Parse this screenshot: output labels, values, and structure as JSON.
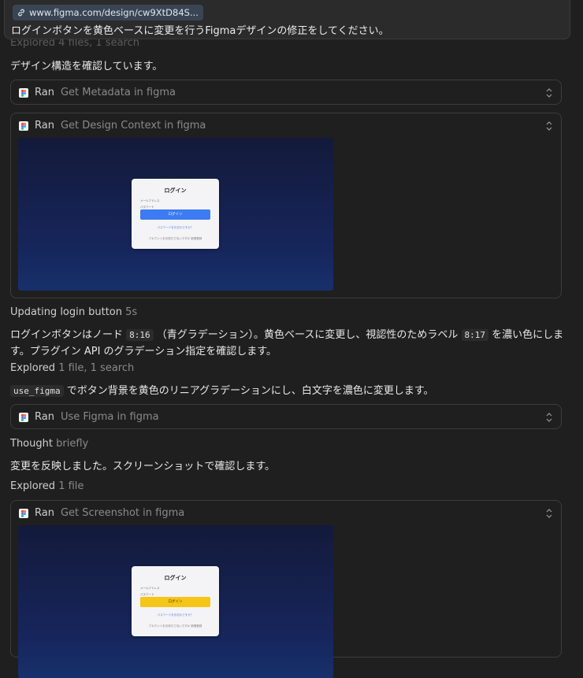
{
  "prompt": {
    "url": "www.figma.com/design/cw9XtD84S...",
    "text": "ログインボタンを黄色ベースに変更を行うFigmaデザインの修正をしてください。"
  },
  "explored_faded": "Explored 4 files, 1 search",
  "msg1": "デザイン構造を確認しています。",
  "tools": {
    "t1": {
      "ran": "Ran",
      "name": "Get Metadata in figma"
    },
    "t2": {
      "ran": "Ran",
      "name": "Get Design Context in figma"
    },
    "t3": {
      "ran": "Ran",
      "name": "Use Figma in figma"
    },
    "t4": {
      "ran": "Ran",
      "name": "Get Screenshot in figma"
    }
  },
  "preview1": {
    "title": "ログイン",
    "field1": "メールアドレス",
    "field2": "パスワード",
    "button": "ログイン",
    "link1": "パスワードをお忘れですか？",
    "link2": "アカウントをお持ちでないですか 新規登録",
    "button_color": "#3d7bf2",
    "button_text_color": "#ffffff"
  },
  "preview2": {
    "title": "ログイン",
    "field1": "メールアドレス",
    "field2": "パスワード",
    "button": "ログイン",
    "link1": "パスワードをお忘れですか？",
    "link2": "アカウントをお持ちでないですか 新規登録",
    "button_color": "#f5c518",
    "button_text_color": "#3a2a00"
  },
  "updating": {
    "label": "Updating login button",
    "time": "5s"
  },
  "para1": {
    "a": "ログインボタンはノード",
    "code1": "8:16",
    "b": "（青グラデーション）。黄色ベースに変更し、視認性のためラベル",
    "code2": "8:17",
    "c": "を濃い色にしま",
    "line2": "す。プラグイン API のグラデーション指定を確認します。"
  },
  "explored2": {
    "label": "Explored",
    "detail": "1 file, 1 search"
  },
  "para2": {
    "code": "use_figma",
    "text": "でボタン背景を黄色のリニアグラデーションにし、白文字を濃色に変更します。"
  },
  "thought": {
    "label": "Thought",
    "detail": "briefly"
  },
  "msg2": "変更を反映しました。スクリーンショットで確認します。",
  "explored3": {
    "label": "Explored",
    "detail": "1 file"
  }
}
